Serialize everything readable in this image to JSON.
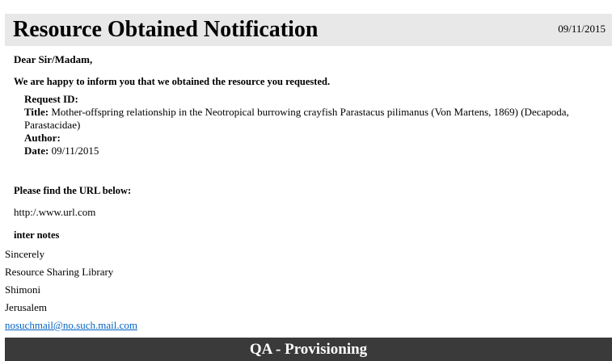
{
  "header": {
    "title": "Resource Obtained Notification",
    "date": "09/11/2015"
  },
  "greeting": "Dear Sir/Madam,",
  "intro": "We are happy to inform you that we obtained the resource you requested.",
  "details": {
    "request_id_label": "Request ID:",
    "title_label": "Title:",
    "title_value": "Mother-offspring relationship in the Neotropical burrowing crayfish Parastacus pilimanus (Von Martens, 1869) (Decapoda, Parastacidae)",
    "author_label": "Author:",
    "date_label": "Date:",
    "date_value": "09/11/2015"
  },
  "url_heading": "Please find the URL below:",
  "url": "http:/.www.url.com",
  "notes": "inter notes",
  "signature": {
    "closing": "Sincerely",
    "library": "Resource Sharing Library",
    "name": "Shimoni",
    "city": "Jerusalem",
    "email": "nosuchmail@no.such.mail.com"
  },
  "footer": {
    "label": "QA - Provisioning"
  }
}
